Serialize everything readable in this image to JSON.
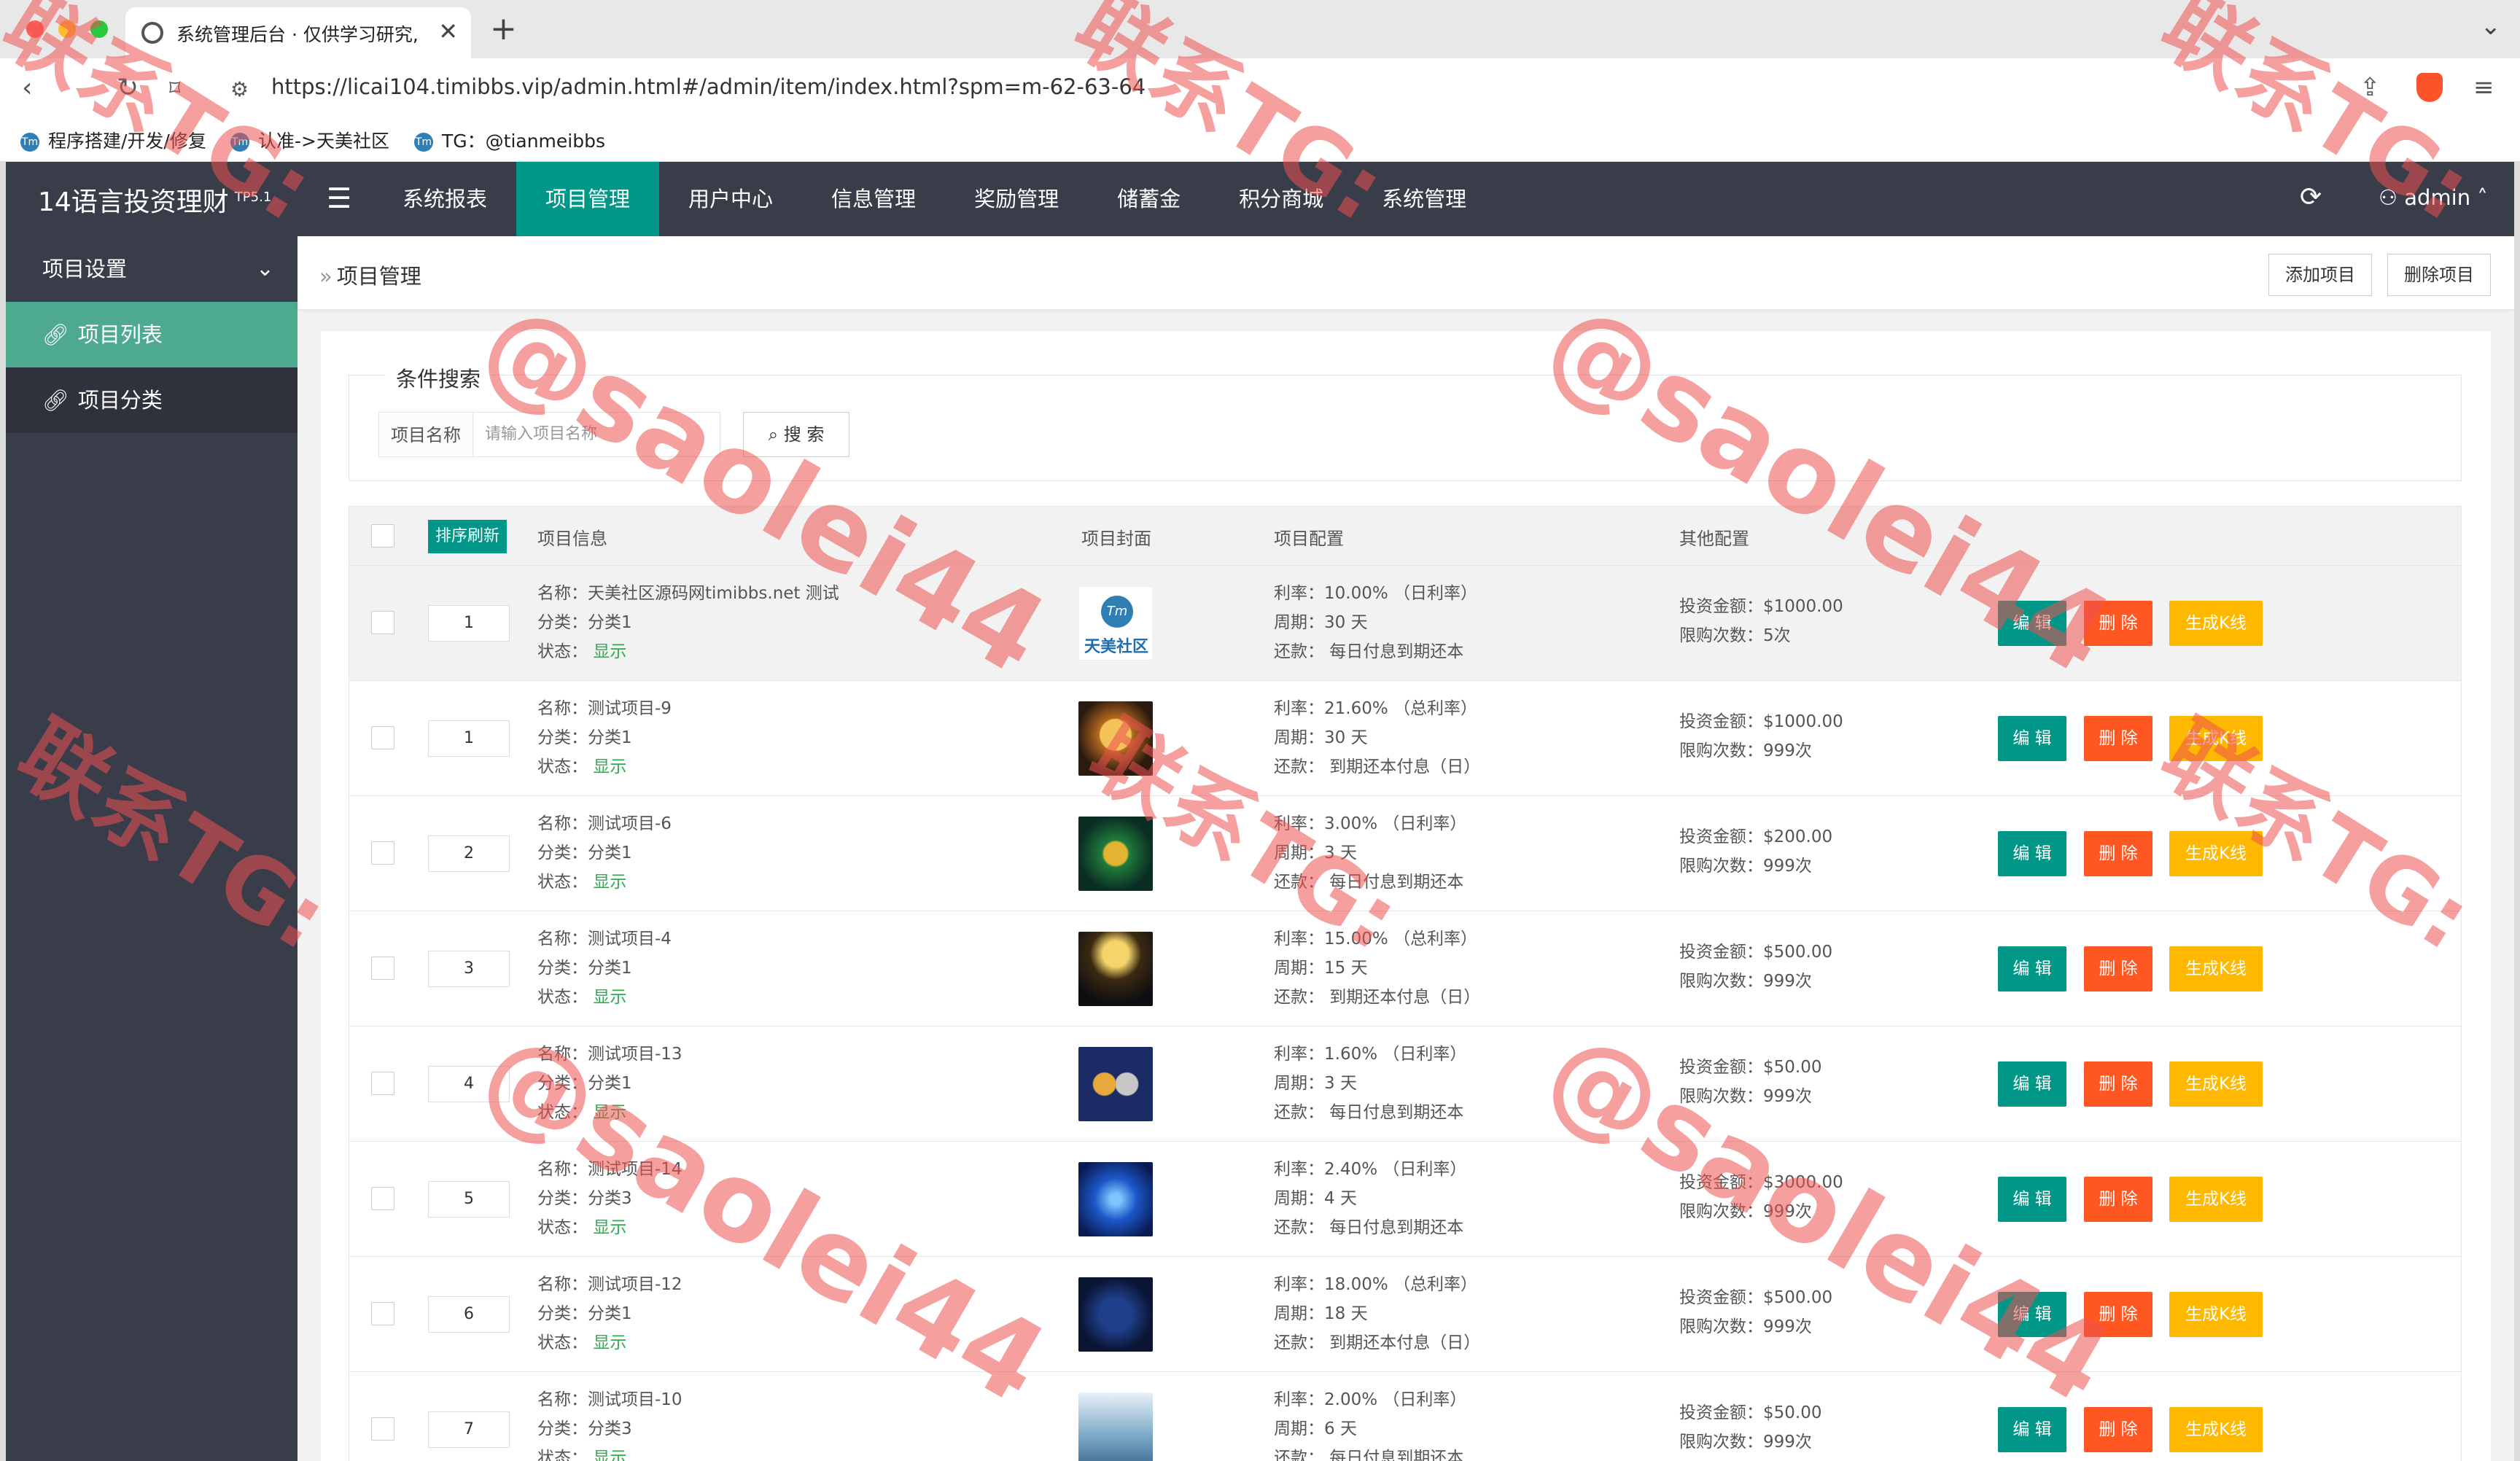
{
  "browser": {
    "tab_title": "系统管理后台 · 仅供学习研究,",
    "url": "https://licai104.timibbs.vip/admin.html#/admin/item/index.html?spm=m-62-63-64",
    "bookmarks": [
      {
        "label": "程序搭建/开发/修复"
      },
      {
        "label": "认准->天美社区"
      },
      {
        "label": "TG：@tianmeibbs"
      }
    ]
  },
  "app": {
    "logo": "14语言投资理财",
    "version": "TP5.1",
    "menu": [
      {
        "label": "系统报表"
      },
      {
        "label": "项目管理"
      },
      {
        "label": "用户中心"
      },
      {
        "label": "信息管理"
      },
      {
        "label": "奖励管理"
      },
      {
        "label": "储蓄金"
      },
      {
        "label": "积分商城"
      },
      {
        "label": "系统管理"
      }
    ],
    "user": "admin"
  },
  "sidebar": {
    "group": "项目设置",
    "items": [
      {
        "label": "项目列表"
      },
      {
        "label": "项目分类"
      }
    ]
  },
  "page": {
    "breadcrumb": "项目管理",
    "add_button": "添加项目",
    "delete_button": "删除项目"
  },
  "search": {
    "legend": "条件搜索",
    "label": "项目名称",
    "placeholder": "请输入项目名称",
    "button": "搜 索"
  },
  "table": {
    "sort_button": "排序刷新",
    "headers": {
      "info": "项目信息",
      "cover": "项目封面",
      "config": "项目配置",
      "other": "其他配置"
    },
    "rows": [
      {
        "sort": "1",
        "name": "名称：天美社区源码网timibbs.net 测试",
        "category": "分类：分类1",
        "status_label": "状态：",
        "status": "显示",
        "rate": "利率：10.00% （日利率）",
        "period": "周期：30 天",
        "repay": "还款：  每日付息到期还本",
        "amount": "投资金额：$1000.00",
        "limit": "限购次数：5次",
        "cover": "logo"
      },
      {
        "sort": "1",
        "name": "名称：测试项目-9",
        "category": "分类：分类1",
        "status_label": "状态：",
        "status": "显示",
        "rate": "利率：21.60% （总利率）",
        "period": "周期：30 天",
        "repay": "还款：  到期还本付息（日）",
        "amount": "投资金额：$1000.00",
        "limit": "限购次数：999次",
        "cover": "doge"
      },
      {
        "sort": "2",
        "name": "名称：测试项目-6",
        "category": "分类：分类1",
        "status_label": "状态：",
        "status": "显示",
        "rate": "利率：3.00% （日利率）",
        "period": "周期：3 天",
        "repay": "还款：  每日付息到期还本",
        "amount": "投资金额：$200.00",
        "limit": "限购次数：999次",
        "cover": "btc-green"
      },
      {
        "sort": "3",
        "name": "名称：测试项目-4",
        "category": "分类：分类1",
        "status_label": "状态：",
        "status": "显示",
        "rate": "利率：15.00% （总利率）",
        "period": "周期：15 天",
        "repay": "还款：  到期还本付息（日）",
        "amount": "投资金额：$500.00",
        "limit": "限购次数：999次",
        "cover": "people"
      },
      {
        "sort": "4",
        "name": "名称：测试项目-13",
        "category": "分类：分类1",
        "status_label": "状态：",
        "status": "显示",
        "rate": "利率：1.60% （日利率）",
        "period": "周期：3 天",
        "repay": "还款：  每日付息到期还本",
        "amount": "投资金额：$50.00",
        "limit": "限购次数：999次",
        "cover": "coins"
      },
      {
        "sort": "5",
        "name": "名称：测试项目-14",
        "category": "分类：分类3",
        "status_label": "状态：",
        "status": "显示",
        "rate": "利率：2.40% （日利率）",
        "period": "周期：4 天",
        "repay": "还款：  每日付息到期还本",
        "amount": "投资金额：$3000.00",
        "limit": "限购次数：999次",
        "cover": "blue"
      },
      {
        "sort": "6",
        "name": "名称：测试项目-12",
        "category": "分类：分类1",
        "status_label": "状态：",
        "status": "显示",
        "rate": "利率：18.00% （总利率）",
        "period": "周期：18 天",
        "repay": "还款：  到期还本付息（日）",
        "amount": "投资金额：$500.00",
        "limit": "限购次数：999次",
        "cover": "globe"
      },
      {
        "sort": "7",
        "name": "名称：测试项目-10",
        "category": "分类：分类3",
        "status_label": "状态：",
        "status": "显示",
        "rate": "利率：2.00% （日利率）",
        "period": "周期：6 天",
        "repay": "还款：  每日付息到期还本",
        "amount": "投资金额：$50.00",
        "limit": "限购次数：999次",
        "cover": "tornado"
      }
    ],
    "btn_edit": "编 辑",
    "btn_delete": "删 除",
    "btn_kline": "生成K线"
  },
  "watermarks": {
    "contact": "联系TG:",
    "handle": "@saolei44"
  },
  "colors": {
    "nav_bg": "#393d49",
    "accent": "#009688",
    "danger": "#ff5722",
    "warning": "#ffb800",
    "sidebar_active": "#4daa8f"
  }
}
